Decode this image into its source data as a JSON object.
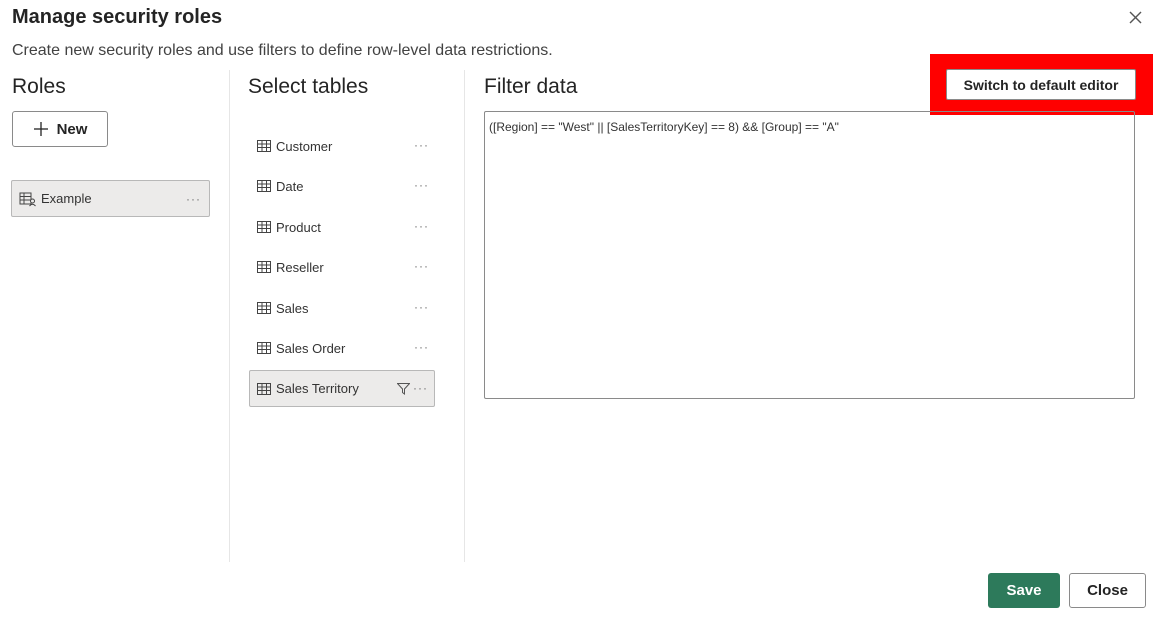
{
  "dialog": {
    "title": "Manage security roles",
    "subtitle": "Create new security roles and use filters to define row-level data restrictions."
  },
  "roles": {
    "header": "Roles",
    "new_button_label": "New",
    "items": [
      {
        "label": "Example",
        "icon": "role-icon",
        "selected": true
      }
    ]
  },
  "tables": {
    "header": "Select tables",
    "items": [
      {
        "label": "Customer",
        "icon": "table-icon"
      },
      {
        "label": "Date",
        "icon": "table-icon"
      },
      {
        "label": "Product",
        "icon": "table-icon"
      },
      {
        "label": "Reseller",
        "icon": "table-icon"
      },
      {
        "label": "Sales",
        "icon": "table-icon"
      },
      {
        "label": "Sales Order",
        "icon": "table-icon"
      },
      {
        "label": "Sales Territory",
        "icon": "table-icon",
        "selected": true,
        "filtered": true
      }
    ]
  },
  "filter": {
    "header": "Filter data",
    "switch_button_label": "Switch to default editor",
    "expression": "([Region] == \"West\" || [SalesTerritoryKey] == 8) && [Group] == \"A\""
  },
  "footer": {
    "save_label": "Save",
    "close_label": "Close"
  },
  "colors": {
    "accent_save": "#2d7a5b",
    "highlight": "#ff0000",
    "selected_bg": "#ecebea"
  }
}
